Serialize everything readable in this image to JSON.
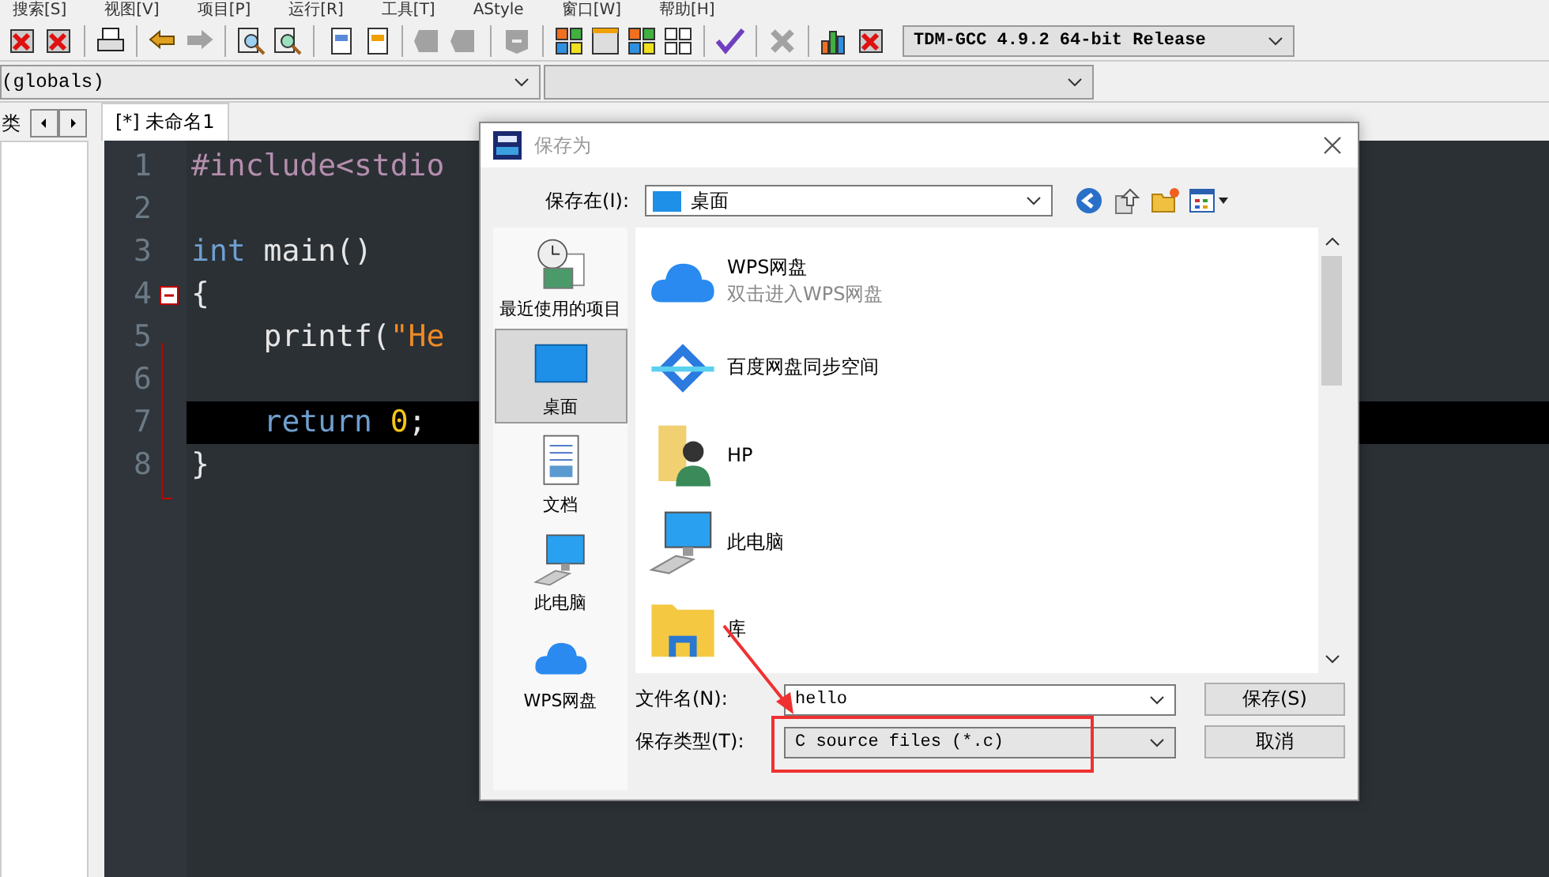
{
  "menu": [
    "搜索[S]",
    "视图[V]",
    "项目[P]",
    "运行[R]",
    "工具[T]",
    "AStyle",
    "窗口[W]",
    "帮助[H]"
  ],
  "toolbar": [
    [
      {
        "kind": "close",
        "disabled": false
      },
      {
        "kind": "closeall",
        "disabled": false
      }
    ],
    [
      {
        "kind": "print",
        "disabled": false
      }
    ],
    [
      {
        "kind": "undo",
        "disabled": false
      },
      {
        "kind": "redo",
        "disabled": true
      }
    ],
    [
      {
        "kind": "find",
        "disabled": false
      },
      {
        "kind": "replace",
        "disabled": false
      }
    ],
    [
      {
        "kind": "indent",
        "disabled": false
      },
      {
        "kind": "unindent",
        "disabled": false
      }
    ],
    [
      {
        "kind": "bookmark",
        "disabled": true
      },
      {
        "kind": "bookmark",
        "disabled": true
      }
    ],
    [
      {
        "kind": "comment",
        "disabled": true
      }
    ],
    [
      {
        "kind": "grid",
        "disabled": false
      },
      {
        "kind": "window",
        "disabled": false
      },
      {
        "kind": "colors",
        "disabled": false
      },
      {
        "kind": "tiles",
        "disabled": false
      }
    ],
    [
      {
        "kind": "check",
        "disabled": false
      }
    ],
    [
      {
        "kind": "cross",
        "disabled": true
      }
    ],
    [
      {
        "kind": "chart",
        "disabled": false
      },
      {
        "kind": "stop",
        "disabled": false
      }
    ]
  ],
  "compiler": {
    "value": "TDM-GCC 4.9.2 64-bit Release"
  },
  "scope_combo": {
    "value": "(globals)"
  },
  "left_panel": {
    "tab": "类"
  },
  "editor_tabs": [
    {
      "label": "[*] 未命名1",
      "selected": true
    }
  ],
  "code": [
    {
      "number": "1",
      "highlighted": false,
      "tokens": [
        {
          "kind": "pre",
          "text": "#include<stdio"
        }
      ]
    },
    {
      "number": "2",
      "highlighted": false
    },
    {
      "number": "3",
      "highlighted": false,
      "tokens": [
        {
          "kind": "kw",
          "text": "int"
        },
        {
          "kind": "plain",
          "text": "main()"
        }
      ]
    },
    {
      "number": "4",
      "highlighted": false,
      "fold": true,
      "tokens": [
        {
          "kind": "plain",
          "text": "{"
        }
      ]
    },
    {
      "number": "5",
      "highlighted": false,
      "indent": true,
      "tokens": [
        {
          "kind": "plain",
          "text": "printf("
        },
        {
          "kind": "str",
          "text": "\"He"
        }
      ]
    },
    {
      "number": "6",
      "highlighted": false
    },
    {
      "number": "7",
      "highlighted": true,
      "indent": true,
      "tokens": [
        {
          "kind": "kw",
          "text": "return"
        },
        {
          "kind": "num",
          "text": "0"
        },
        {
          "kind": "plain",
          "text": ";"
        }
      ]
    },
    {
      "number": "8",
      "highlighted": false,
      "tokens": [
        {
          "kind": "plain",
          "text": "}"
        }
      ]
    }
  ],
  "dialog": {
    "title": "保存为",
    "location_label": "保存在(I):",
    "location": "桌面",
    "places": [
      {
        "label": "最近使用的项目",
        "kind": "recent",
        "selected": false
      },
      {
        "label": "桌面",
        "kind": "desktop",
        "selected": true
      },
      {
        "label": "文档",
        "kind": "document",
        "selected": false
      },
      {
        "label": "此电脑",
        "kind": "computer",
        "selected": false
      },
      {
        "label": "WPS网盘",
        "kind": "cloud",
        "selected": false
      }
    ],
    "files": [
      {
        "name": "WPS网盘",
        "subtitle": "双击进入WPS网盘",
        "kind": "cloud"
      },
      {
        "name": "百度网盘同步空间",
        "kind": "sync"
      },
      {
        "name": "HP",
        "kind": "user-folder"
      },
      {
        "name": "此电脑",
        "kind": "computer"
      },
      {
        "name": "库",
        "kind": "library"
      }
    ],
    "filename_label": "文件名(N):",
    "filename": "hello",
    "filetype_label": "保存类型(T):",
    "filetype": "C source files (*.c)",
    "buttons": [
      "保存(S)",
      "取消"
    ]
  }
}
